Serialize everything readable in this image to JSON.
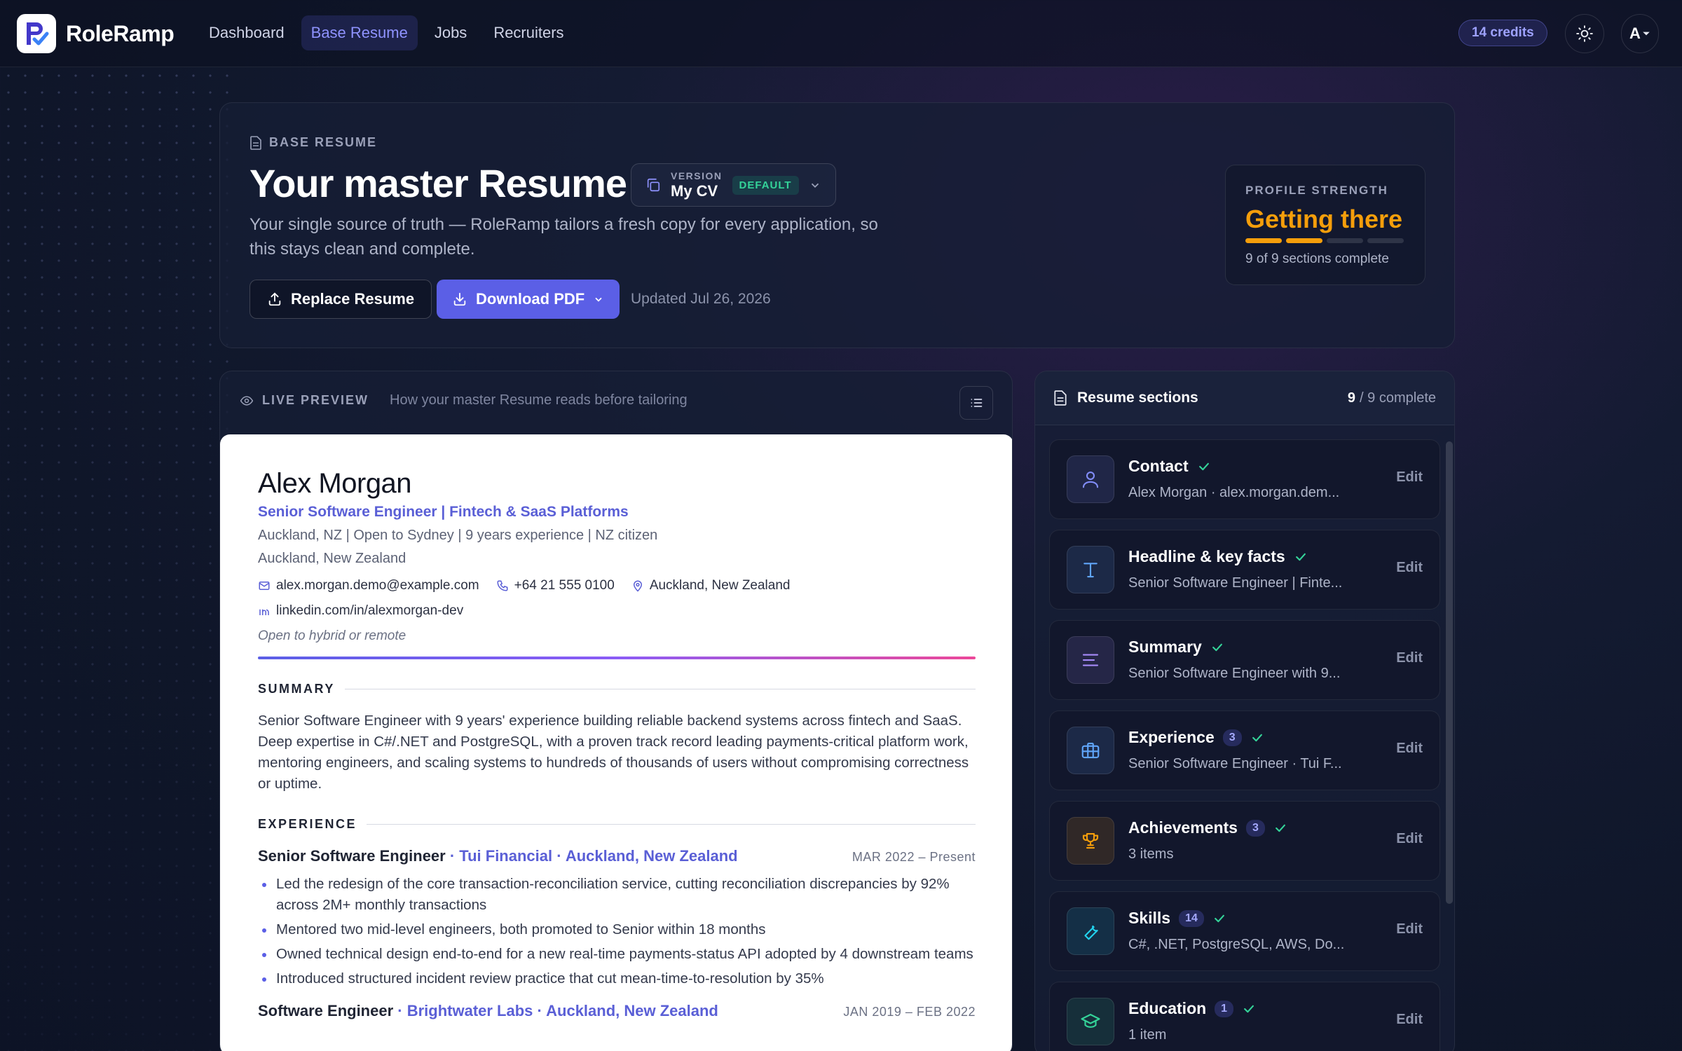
{
  "nav": {
    "brand": "RoleRamp",
    "links": [
      {
        "label": "Dashboard"
      },
      {
        "label": "Base Resume"
      },
      {
        "label": "Jobs"
      },
      {
        "label": "Recruiters"
      }
    ],
    "credits": "14 credits",
    "avatar": "A"
  },
  "hero": {
    "eyebrow": "BASE RESUME",
    "title": "Your master Resume",
    "version_label": "VERSION",
    "version_name": "My CV",
    "version_badge": "DEFAULT",
    "subtitle": "Your single source of truth — RoleRamp tailors a fresh copy for every application, so this stays clean and complete.",
    "replace_button": "Replace Resume",
    "download_button": "Download PDF",
    "updated": "Updated Jul 26, 2026",
    "strength": {
      "label": "PROFILE STRENGTH",
      "value": "Getting there",
      "level": 0.5,
      "note": "9 of 9 sections complete"
    }
  },
  "preview": {
    "label": "LIVE PREVIEW",
    "hint": "How your master Resume reads before tailoring",
    "resume": {
      "name": "Alex Morgan",
      "headline": "Senior Software Engineer | Fintech & SaaS Platforms",
      "facts": "Auckland, NZ | Open to Sydney | 9 years experience | NZ citizen",
      "location": "Auckland, New Zealand",
      "email": "alex.morgan.demo@example.com",
      "phone": "+64 21 555 0100",
      "place": "Auckland, New Zealand",
      "linkedin": "linkedin.com/in/alexmorgan-dev",
      "note": "Open to hybrid or remote",
      "summary_heading": "SUMMARY",
      "summary": "Senior Software Engineer with 9 years' experience building reliable backend systems across fintech and SaaS. Deep expertise in C#/.NET and PostgreSQL, with a proven track record leading payments-critical platform work, mentoring engineers, and scaling systems to hundreds of thousands of users without compromising correctness or uptime.",
      "experience_heading": "EXPERIENCE",
      "jobs": [
        {
          "title": "Senior Software Engineer",
          "company": " · Tui Financial · Auckland, New Zealand",
          "dates": "MAR 2022 – Present",
          "bullets": [
            "Led the redesign of the core transaction-reconciliation service, cutting reconciliation discrepancies by 92% across 2M+ monthly transactions",
            "Mentored two mid-level engineers, both promoted to Senior within 18 months",
            "Owned technical design end-to-end for a new real-time payments-status API adopted by 4 downstream teams",
            "Introduced structured incident review practice that cut mean-time-to-resolution by 35%"
          ]
        },
        {
          "title": "Software Engineer",
          "company": " · Brightwater Labs · Auckland, New Zealand",
          "dates": "JAN 2019 – FEB 2022"
        }
      ]
    }
  },
  "sections": {
    "title": "Resume sections",
    "complete_count": "9",
    "complete_total": "/ 9 complete",
    "items": [
      {
        "title": "Contact",
        "count": "",
        "summary": "Alex Morgan · alex.morgan.dem...",
        "edit": "Edit",
        "icon": "user-icon",
        "color": "#818cf8"
      },
      {
        "title": "Headline & key facts",
        "count": "",
        "summary": "Senior Software Engineer | Finte...",
        "edit": "Edit",
        "icon": "text-icon",
        "color": "#60a5fa"
      },
      {
        "title": "Summary",
        "count": "",
        "summary": "Senior Software Engineer with 9...",
        "edit": "Edit",
        "icon": "lines-icon",
        "color": "#a78bfa"
      },
      {
        "title": "Experience",
        "count": "3",
        "summary": "Senior Software Engineer · Tui F...",
        "edit": "Edit",
        "icon": "briefcase-icon",
        "color": "#60a5fa"
      },
      {
        "title": "Achievements",
        "count": "3",
        "summary": "3 items",
        "edit": "Edit",
        "icon": "trophy-icon",
        "color": "#f59e0b"
      },
      {
        "title": "Skills",
        "count": "14",
        "summary": "C#, .NET, PostgreSQL, AWS, Do...",
        "edit": "Edit",
        "icon": "wrench-icon",
        "color": "#22d3ee"
      },
      {
        "title": "Education",
        "count": "1",
        "summary": "1 item",
        "edit": "Edit",
        "icon": "graduation-cap-icon",
        "color": "#34d399"
      }
    ]
  }
}
